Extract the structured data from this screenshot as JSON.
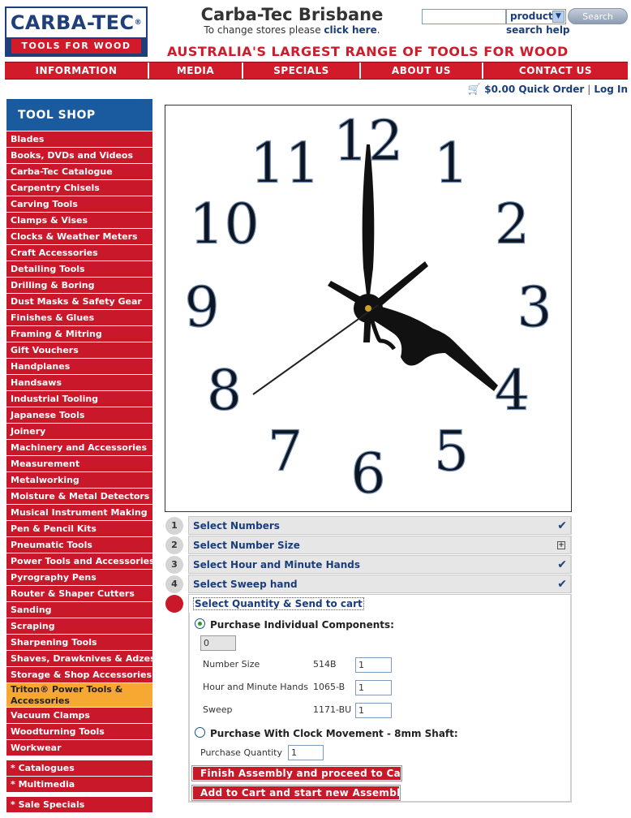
{
  "header": {
    "logo_top": "CARBA-TEC",
    "logo_reg": "®",
    "logo_bottom": "TOOLS FOR WOOD",
    "store_title": "Carba-Tec Brisbane",
    "store_sub_text": "To change stores please ",
    "store_sub_link": "click here",
    "store_sub_end": ".",
    "search_value": "",
    "search_select": "product",
    "search_button": "Search",
    "search_help": "search help",
    "tagline": "AUSTRALIA'S LARGEST RANGE OF TOOLS FOR WOOD"
  },
  "nav": [
    "INFORMATION",
    "MEDIA",
    "SPECIALS",
    "ABOUT US",
    "CONTACT US"
  ],
  "cart": {
    "total": "$0.00",
    "quick_order": "Quick Order",
    "separator": "|",
    "login": "Log In"
  },
  "sidebar": {
    "title": "TOOL SHOP",
    "categories": [
      "Blades",
      "Books, DVDs and Videos",
      "Carba-Tec Catalogue",
      "Carpentry Chisels",
      "Carving Tools",
      "Clamps & Vises",
      "Clocks & Weather Meters",
      "Craft Accessories",
      "Detailing Tools",
      "Drilling & Boring",
      "Dust Masks & Safety Gear",
      "Finishes & Glues",
      "Framing & Mitring",
      "Gift Vouchers",
      "Handplanes",
      "Handsaws",
      "Industrial Tooling",
      "Japanese Tools",
      "Joinery",
      "Machinery and Accessories",
      "Measurement",
      "Metalworking",
      "Moisture & Metal Detectors",
      "Musical Instrument Making",
      "Pen & Pencil Kits",
      "Pneumatic Tools",
      "Power Tools and Accessories",
      "Pyrography Pens",
      "Router & Shaper Cutters",
      "Sanding",
      "Scraping",
      "Sharpening Tools",
      "Shaves, Drawknives & Adzes",
      "Storage & Shop Accessories"
    ],
    "highlight": "Triton® Power Tools & Accessories",
    "categories_after": [
      "Vacuum Clamps",
      "Woodturning Tools",
      "Workwear"
    ],
    "extras": [
      "* Catalogues",
      "* Multimedia"
    ],
    "extras2": [
      "* Sale Specials"
    ]
  },
  "clock": {
    "numerals": [
      "12",
      "1",
      "2",
      "3",
      "4",
      "5",
      "6",
      "7",
      "8",
      "9",
      "10",
      "11"
    ]
  },
  "steps": [
    {
      "num": "1",
      "title": "Select Numbers",
      "mark": "✔"
    },
    {
      "num": "2",
      "title": "Select Number Size",
      "mark": "+"
    },
    {
      "num": "3",
      "title": "Select Hour and Minute Hands",
      "mark": "✔"
    },
    {
      "num": "4",
      "title": "Select Sweep hand",
      "mark": "✔"
    },
    {
      "num": "5",
      "title": "Select Quantity & Send to cart",
      "mark": ""
    }
  ],
  "step5": {
    "option1_label": "Purchase Individual Components:",
    "option1_qty": "0",
    "components": [
      {
        "name": "Number Size",
        "code": "514B",
        "qty": "1"
      },
      {
        "name": "Hour and Minute Hands",
        "code": "1065-B",
        "qty": "1"
      },
      {
        "name": "Sweep",
        "code": "1171-BU",
        "qty": "1"
      }
    ],
    "option2_label": "Purchase With Clock Movement - 8mm Shaft:",
    "purchase_qty_label": "Purchase Quantity",
    "purchase_qty": "1",
    "finish_button": "Finish Assembly and proceed to Cart",
    "add_button": "Add to Cart and start new Assembly"
  }
}
